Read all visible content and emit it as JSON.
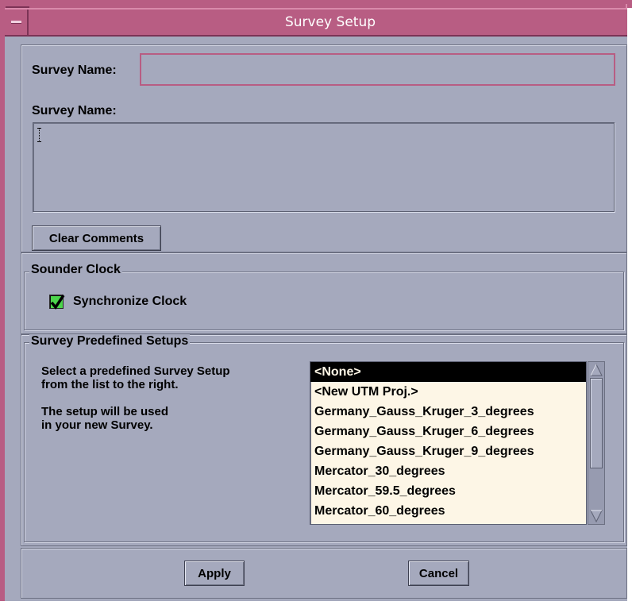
{
  "window": {
    "title": "Survey Setup"
  },
  "survey_name": {
    "label": "Survey Name:",
    "value": ""
  },
  "comments": {
    "label": "Survey Name:",
    "value": ""
  },
  "clear_comments_button": "Clear Comments",
  "sounder_clock": {
    "group_title": "Sounder Clock",
    "checkbox_label": "Synchronize Clock",
    "checked": true
  },
  "predefined": {
    "group_title": "Survey Predefined Setups",
    "instructions": [
      "Select a predefined Survey Setup",
      "from the list to the right.",
      "",
      "The setup will be used",
      "in your new Survey."
    ],
    "selected": "<None>",
    "items": [
      "<None>",
      "<New UTM Proj.>",
      "Germany_Gauss_Kruger_3_degrees",
      "Germany_Gauss_Kruger_6_degrees",
      "Germany_Gauss_Kruger_9_degrees",
      "Mercator_30_degrees",
      "Mercator_59.5_degrees",
      "Mercator_60_degrees"
    ]
  },
  "buttons": {
    "apply": "Apply",
    "cancel": "Cancel"
  },
  "colors": {
    "titlebar": "#b85d83",
    "background": "#a5a9bd",
    "list_background": "#fdf6e6",
    "selection": "#000000",
    "checkbox": "#4cd44c"
  },
  "icons": {
    "window_menu": "window-menu-icon",
    "checkmark": "checkmark-icon",
    "scroll_up": "up-arrow-icon",
    "scroll_down": "down-arrow-icon",
    "text_cursor": "text-cursor-icon"
  }
}
